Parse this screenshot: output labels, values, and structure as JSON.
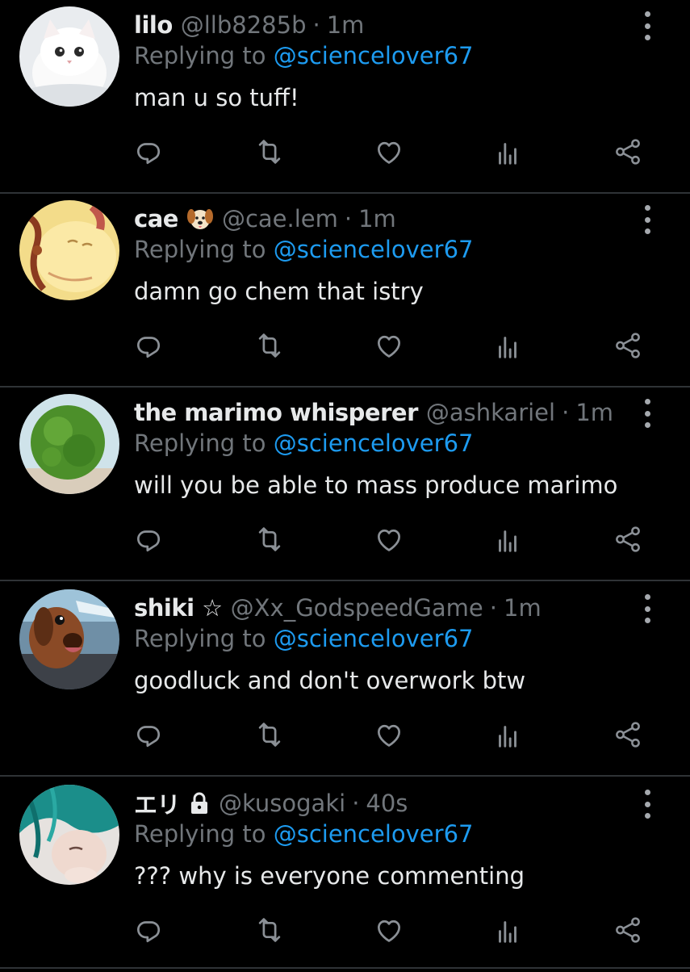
{
  "colors": {
    "background": "#000000",
    "text": "#e7e9ea",
    "muted": "#71767b",
    "accent": "#1d9bf0",
    "divider": "#2f3336"
  },
  "replying_prefix": "Replying to",
  "replies": [
    {
      "name": "lilo",
      "badge": "",
      "handle": "@llb8285b",
      "separator": "·",
      "time": "1m",
      "replying_to": "@sciencelover67",
      "text": "man u so tuff!",
      "avatar": "white-kitten-avatar"
    },
    {
      "name": "cae",
      "badge": "dog-face-emoji",
      "handle": "@cae.lem",
      "separator": "·",
      "time": "1m",
      "replying_to": "@sciencelover67",
      "text": "damn go chem that istry",
      "avatar": "yellow-cartoon-avatar"
    },
    {
      "name": "the marimo whisperer",
      "badge": "",
      "handle": "@ashkariel",
      "separator": "·",
      "time": "1m",
      "replying_to": "@sciencelover67",
      "text": "will you be able to mass produce marimo",
      "avatar": "marimo-moss-ball-avatar"
    },
    {
      "name": "shiki ☆",
      "badge": "",
      "handle": "@Xx_GodspeedGame",
      "separator": "·",
      "time": "1m",
      "replying_to": "@sciencelover67",
      "text": "goodluck and don't overwork btw",
      "avatar": "dachshund-avatar"
    },
    {
      "name": "エリ",
      "badge": "lock-icon",
      "handle": "@kusogaki",
      "separator": "·",
      "time": "40s",
      "replying_to": "@sciencelover67",
      "text": "??? why is everyone commenting",
      "avatar": "teal-hair-person-avatar"
    }
  ],
  "action_icons": [
    "reply-icon",
    "retweet-icon",
    "like-icon",
    "analytics-icon",
    "share-icon"
  ]
}
